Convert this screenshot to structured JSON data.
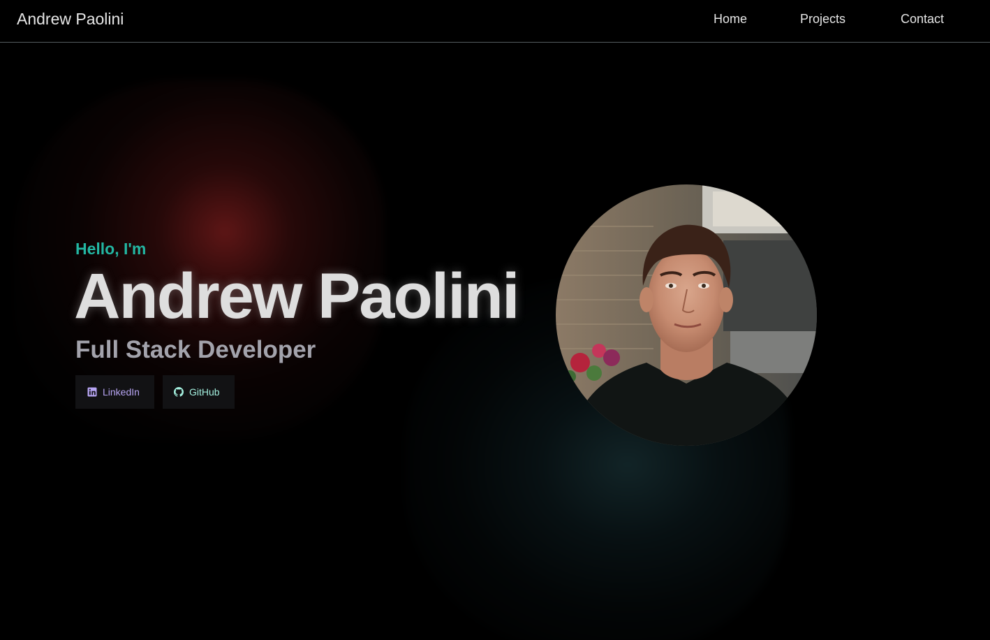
{
  "header": {
    "brand": "Andrew Paolini",
    "nav": {
      "home": "Home",
      "projects": "Projects",
      "contact": "Contact"
    }
  },
  "hero": {
    "greeting": "Hello, I'm",
    "name": "Andrew Paolini",
    "subtitle": "Full Stack Developer",
    "buttons": {
      "linkedin": "LinkedIn",
      "github": "GitHub"
    }
  },
  "colors": {
    "accent_teal": "#23b7a3",
    "linkedin_text": "#b7a5f3",
    "github_text": "#a4f0df",
    "background": "#000000"
  },
  "icons": {
    "linkedin": "linkedin-icon",
    "github": "github-icon"
  }
}
